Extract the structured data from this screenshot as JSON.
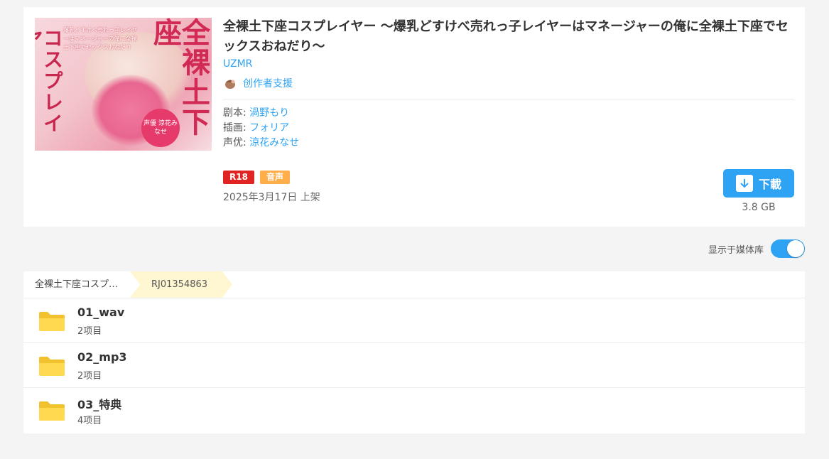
{
  "work": {
    "title": "全裸土下座コスプレイヤー ～爆乳どすけべ売れっ子レイヤーはマネージャーの俺に全裸土下座でセックスおねだり～",
    "circle": "UZMR",
    "support_label": "创作者支援",
    "cover": {
      "blurb": "爆乳どすけべ売れっ子レイヤーはマネージャーの俺に全裸土下座でセックスおねだり",
      "title_left": "コスプレイヤー",
      "title_right": "全裸土下座",
      "badge": "声優 涼花みなせ"
    },
    "credits": [
      {
        "role": "剧本:",
        "name": "渦野もり"
      },
      {
        "role": "插画:",
        "name": "フォリア"
      },
      {
        "role": "声优:",
        "name": "涼花みなせ"
      }
    ],
    "tags": [
      "R18",
      "音声"
    ],
    "release": "2025年3月17日 上架",
    "download_label": "下載",
    "size": "3.8 GB"
  },
  "library_toggle": {
    "label": "显示于媒体库",
    "on": true
  },
  "breadcrumb": {
    "root": "全裸土下座コスプ…",
    "current": "RJ01354863"
  },
  "folders": [
    {
      "name": "01_wav",
      "count": "2项目"
    },
    {
      "name": "02_mp3",
      "count": "2项目"
    },
    {
      "name": "03_特典",
      "count": "4项目"
    }
  ],
  "colors": {
    "accent": "#2fa3f3",
    "r18": "#e02424",
    "voice": "#ffae4a",
    "folder": "#ffd54a"
  }
}
